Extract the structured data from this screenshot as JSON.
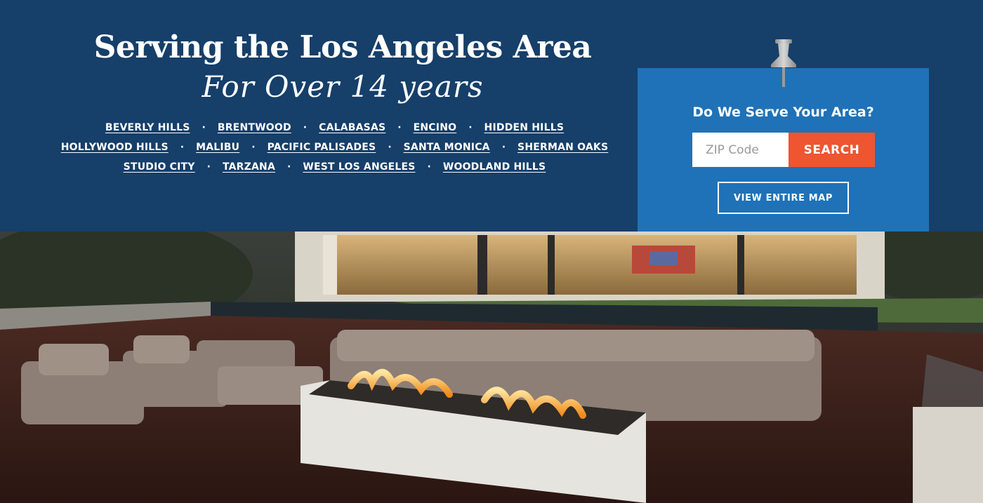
{
  "banner": {
    "headline": "Serving the Los Angeles Area",
    "subheadline": "For Over 14 years",
    "city_rows": [
      [
        "BEVERLY HILLS",
        "BRENTWOOD",
        "CALABASAS",
        "ENCINO",
        "HIDDEN HILLS"
      ],
      [
        "HOLLYWOOD HILLS",
        "MALIBU",
        "PACIFIC PALISADES",
        "SANTA MONICA",
        "SHERMAN OAKS"
      ],
      [
        "STUDIO CITY",
        "TARZANA",
        "WEST LOS ANGELES",
        "WOODLAND HILLS"
      ]
    ],
    "separator": "·"
  },
  "zip_panel": {
    "title": "Do We Serve Your Area?",
    "zip_placeholder": "ZIP Code",
    "zip_value": "",
    "search_label": "SEARCH",
    "map_label": "VIEW ENTIRE MAP"
  },
  "colors": {
    "banner_bg": "#163f69",
    "panel_bg": "#1f72b7",
    "search_bg": "#ee5530",
    "text": "#ffffff"
  },
  "icons": {
    "pin": "push-pin-icon"
  }
}
